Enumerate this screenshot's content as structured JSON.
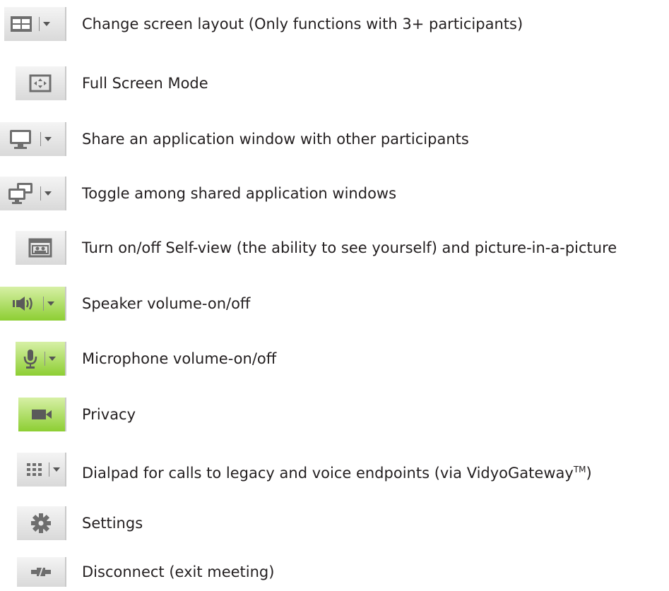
{
  "colors": {
    "gray_button_top": "#f4f4f4",
    "gray_button_bottom": "#d9d9d9",
    "green_button_top": "#d7f0a6",
    "green_button_bottom": "#8dce33",
    "icon_gray": "#6e6e6e",
    "text": "#231f20"
  },
  "items": [
    {
      "icon": "layout-grid-icon",
      "has_dropdown": true,
      "label": "Change screen layout (Only functions with 3+ participants)"
    },
    {
      "icon": "fullscreen-icon",
      "has_dropdown": false,
      "label": "Full Screen Mode"
    },
    {
      "icon": "monitor-icon",
      "has_dropdown": true,
      "label": "Share an application window with other participants"
    },
    {
      "icon": "dual-monitor-icon",
      "has_dropdown": true,
      "label": "Toggle among shared application windows"
    },
    {
      "icon": "self-view-icon",
      "has_dropdown": false,
      "label": "Turn on/off Self-view (the ability to see yourself) and picture-in-a-picture"
    },
    {
      "icon": "speaker-icon",
      "has_dropdown": true,
      "label": "Speaker volume-on/off"
    },
    {
      "icon": "microphone-icon",
      "has_dropdown": true,
      "label": "Microphone volume-on/off"
    },
    {
      "icon": "video-camera-icon",
      "has_dropdown": false,
      "label": "Privacy"
    },
    {
      "icon": "dialpad-icon",
      "has_dropdown": true,
      "label": "Dialpad for calls to legacy and voice endpoints (via VidyoGateway",
      "label_suffix": "TM",
      "label_end": ")"
    },
    {
      "icon": "gear-icon",
      "has_dropdown": false,
      "label": "Settings"
    },
    {
      "icon": "disconnect-icon",
      "has_dropdown": false,
      "label": "Disconnect (exit meeting)"
    }
  ]
}
